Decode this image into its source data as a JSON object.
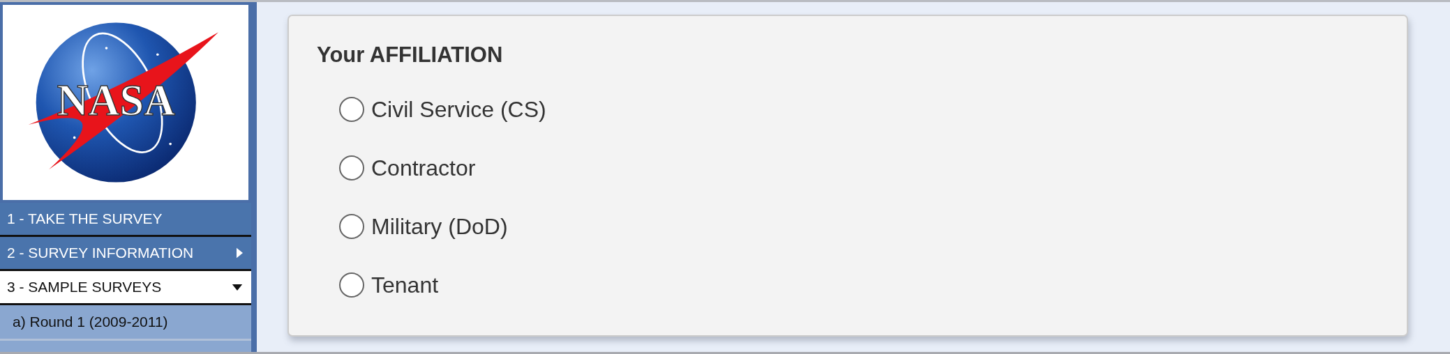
{
  "logo": {
    "text": "NASA"
  },
  "nav": [
    {
      "label": "1 - TAKE THE SURVEY",
      "kind": "link",
      "selected": false
    },
    {
      "label": "2 - SURVEY INFORMATION",
      "kind": "menu",
      "selected": false,
      "expanded": false
    },
    {
      "label": "3 - SAMPLE SURVEYS",
      "kind": "menu",
      "selected": true,
      "expanded": true,
      "children": [
        {
          "label": "a) Round 1 (2009-2011)"
        }
      ]
    }
  ],
  "question": {
    "title": "Your AFFILIATION",
    "options": [
      {
        "label": "Civil Service (CS)",
        "selected": false
      },
      {
        "label": "Contractor",
        "selected": false
      },
      {
        "label": "Military (DoD)",
        "selected": false
      },
      {
        "label": "Tenant",
        "selected": false
      }
    ]
  }
}
